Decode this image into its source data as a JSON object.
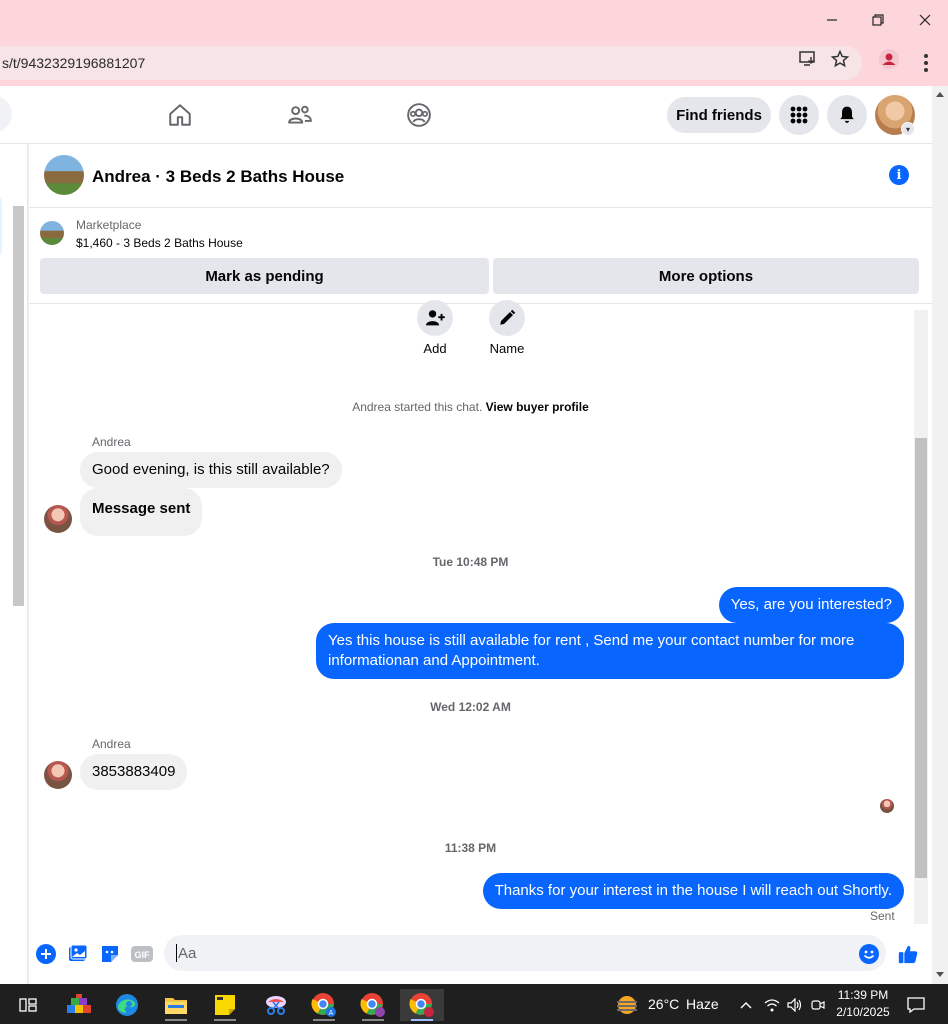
{
  "browser": {
    "url_fragment": "s/t/9432329196881207"
  },
  "fb_nav": {
    "find_friends": "Find friends"
  },
  "chat": {
    "title": "Andrea · 3 Beds 2 Baths House",
    "marketplace_label": "Marketplace",
    "listing": "$1,460 - 3 Beds 2 Baths House",
    "mark_pending": "Mark as pending",
    "more_options": "More options",
    "actions": {
      "add": "Add",
      "name": "Name"
    },
    "started_text": "Andrea started this chat.",
    "view_profile": "View buyer profile",
    "messages": [
      {
        "sender": "Andrea",
        "text": "Good evening, is this still available?"
      },
      {
        "text": "Message sent"
      },
      {
        "timestamp": "Tue 10:48 PM"
      },
      {
        "text": "Yes, are you interested?"
      },
      {
        "text": "Yes this house is still available for rent , Send me your contact number for more informationan and Appointment."
      },
      {
        "timestamp": "Wed 12:02 AM"
      },
      {
        "sender": "Andrea",
        "text": "3853883409"
      },
      {
        "timestamp": "11:38 PM"
      },
      {
        "text": "Thanks for your interest in the house I will reach out Shortly."
      }
    ],
    "sent_status": "Sent",
    "composer_placeholder": "Aa"
  },
  "taskbar": {
    "weather_temp": "26°C",
    "weather_desc": "Haze",
    "time": "11:39 PM",
    "date": "2/10/2025"
  },
  "colors": {
    "accent_blue": "#0866ff",
    "titlebar_pink": "#fdd6dc"
  },
  "icons": [
    "minimize-icon",
    "restore-icon",
    "close-icon",
    "install-app-icon",
    "star-icon",
    "profile-icon",
    "menu-icon",
    "home-icon",
    "friends-icon",
    "groups-icon",
    "apps-grid-icon",
    "bell-icon",
    "info-icon",
    "add-person-icon",
    "pencil-icon",
    "plus-icon",
    "photo-icon",
    "sticker-icon",
    "gif-icon",
    "emoji-icon",
    "thumbs-up-icon"
  ]
}
